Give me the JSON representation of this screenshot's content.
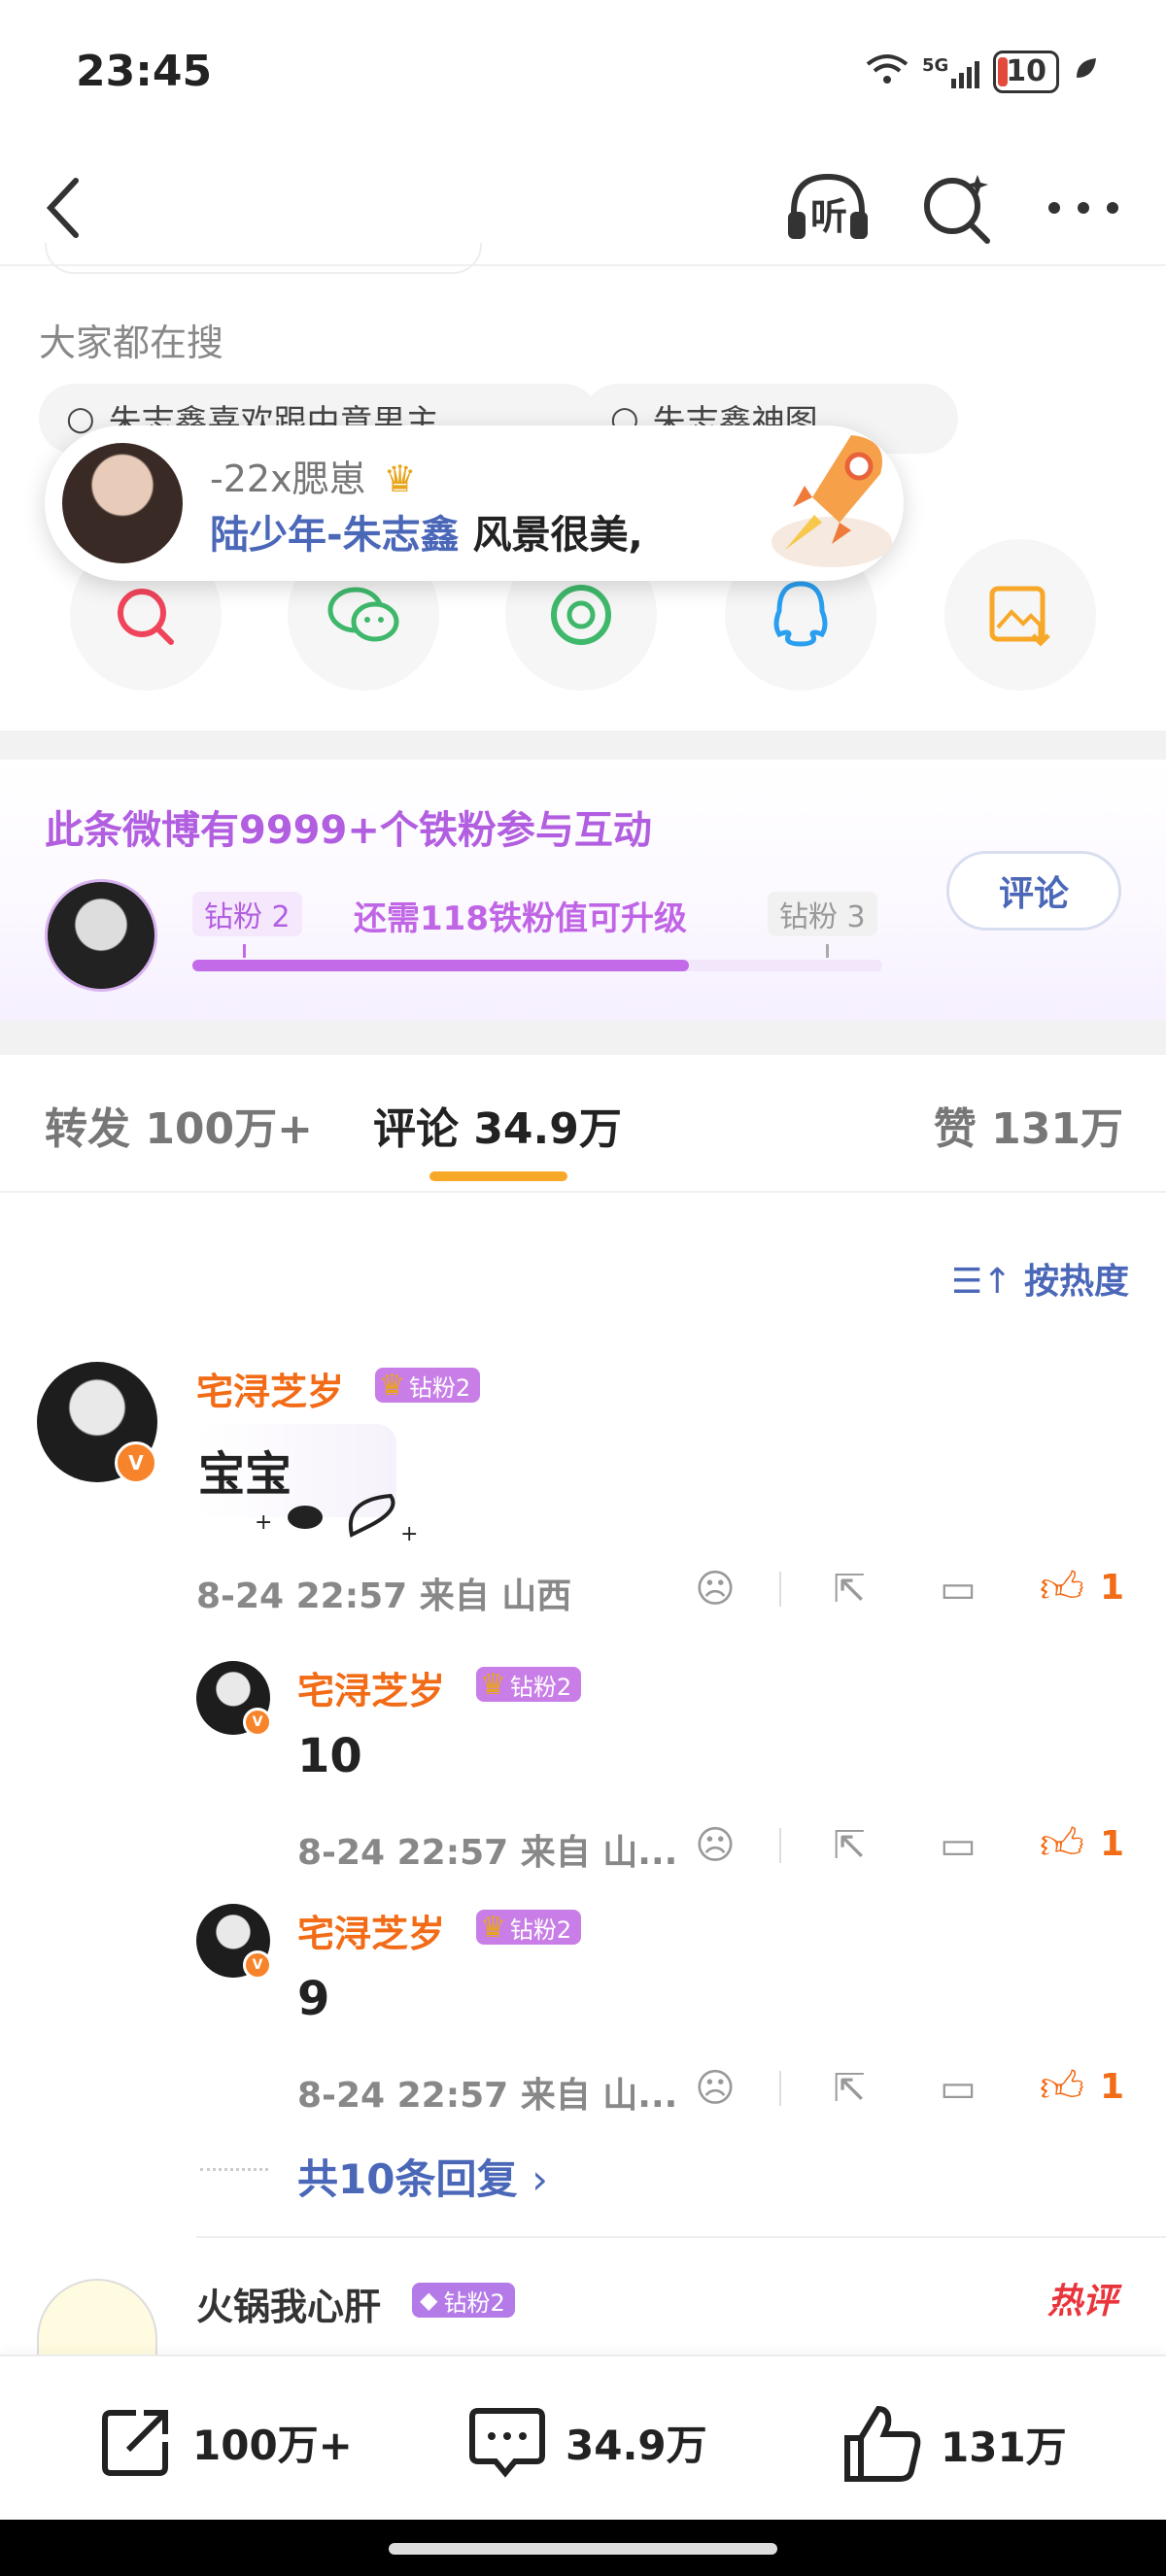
{
  "status_bar": {
    "time": "23:45",
    "network": "5G",
    "battery": "10"
  },
  "nav": {
    "listen_label": "听"
  },
  "search_section": {
    "title": "大家都在搜",
    "chips": [
      "朱志鑫喜欢跟中意男主",
      "朱志鑫神图"
    ]
  },
  "toast": {
    "username": "-22x腮崽",
    "message_highlight": "陆少年-朱志鑫",
    "message_rest": " 风景很美,"
  },
  "fans": {
    "title": "此条微博有9999+个铁粉参与互动",
    "current_level": "钻粉 2",
    "next_level": "钻粉 3",
    "need_text": "还需118铁粉值可升级",
    "progress": 0.72,
    "comment_button": "评论"
  },
  "tabs": {
    "repost": "转发 100万+",
    "comments": "评论 34.9万",
    "likes": "赞 131万"
  },
  "sort_label": "按热度",
  "main_comment": {
    "username": "宅浔芝岁",
    "fan_badge": "钻粉2",
    "text": "宝宝",
    "meta": "8-24 22:57  来自 山西",
    "likes": "1"
  },
  "replies": [
    {
      "username": "宅浔芝岁",
      "fan_badge": "钻粉2",
      "text": "10",
      "meta": "8-24 22:57  来自 山...",
      "likes": "1"
    },
    {
      "username": "宅浔芝岁",
      "fan_badge": "钻粉2",
      "text": "9",
      "meta": "8-24 22:57  来自 山...",
      "likes": "1"
    }
  ],
  "more_replies": "共10条回复",
  "next_comment": {
    "username": "火锅我心肝",
    "fan_badge": "钻粉2",
    "hot_label": "热评"
  },
  "bottom_bar": {
    "repost": "100万+",
    "comments": "34.9万",
    "likes": "131万"
  },
  "colors": {
    "accent_orange": "#f26b16",
    "link_blue": "#4b67b8",
    "fan_purple": "#b25ee0",
    "tab_indicator": "#f7a829"
  }
}
